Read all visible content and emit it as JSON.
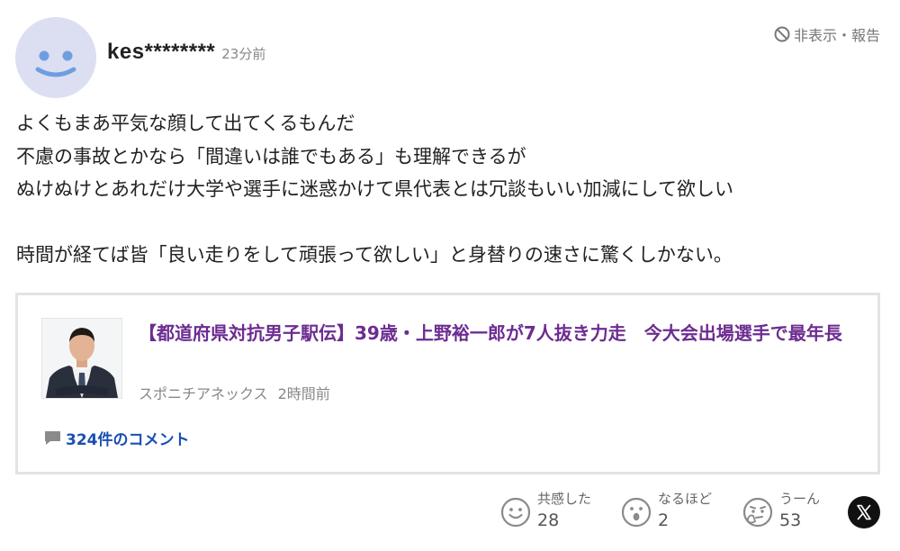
{
  "comment": {
    "author": {
      "username": "kes********",
      "avatar_icon": "smiley-face-icon",
      "avatar_color": "#dcdff2",
      "avatar_face_color": "#6f9ee0"
    },
    "posted_ago": "23分前",
    "hide_report": {
      "icon": "ban-icon",
      "label": "非表示・報告"
    },
    "body_lines": [
      "よくもまあ平気な顔して出てくるもんだ",
      "不慮の事故とかなら「間違いは誰でもある」も理解できるが",
      "ぬけぬけとあれだけ大学や選手に迷惑かけて県代表とは冗談もいい加減にして欲しい",
      "",
      "時間が経てば皆「良い走りをして頑張って欲しい」と身替りの速さに驚くしかない。"
    ]
  },
  "article": {
    "title": "【都道府県対抗男子駅伝】39歳・上野裕一郎が7人抜き力走　今大会出場選手で最年長",
    "source": "スポニチアネックス",
    "published_ago": "2時間前",
    "comments_link": "324件のコメント",
    "title_color": "#6c2c91",
    "link_color": "#1a4fb5"
  },
  "reactions": [
    {
      "label": "共感した",
      "count": "28",
      "icon": "smile-face-icon"
    },
    {
      "label": "なるほど",
      "count": "2",
      "icon": "surprised-face-icon"
    },
    {
      "label": "うーん",
      "count": "53",
      "icon": "thinking-face-icon"
    }
  ],
  "share": {
    "icon": "x-logo-icon"
  }
}
